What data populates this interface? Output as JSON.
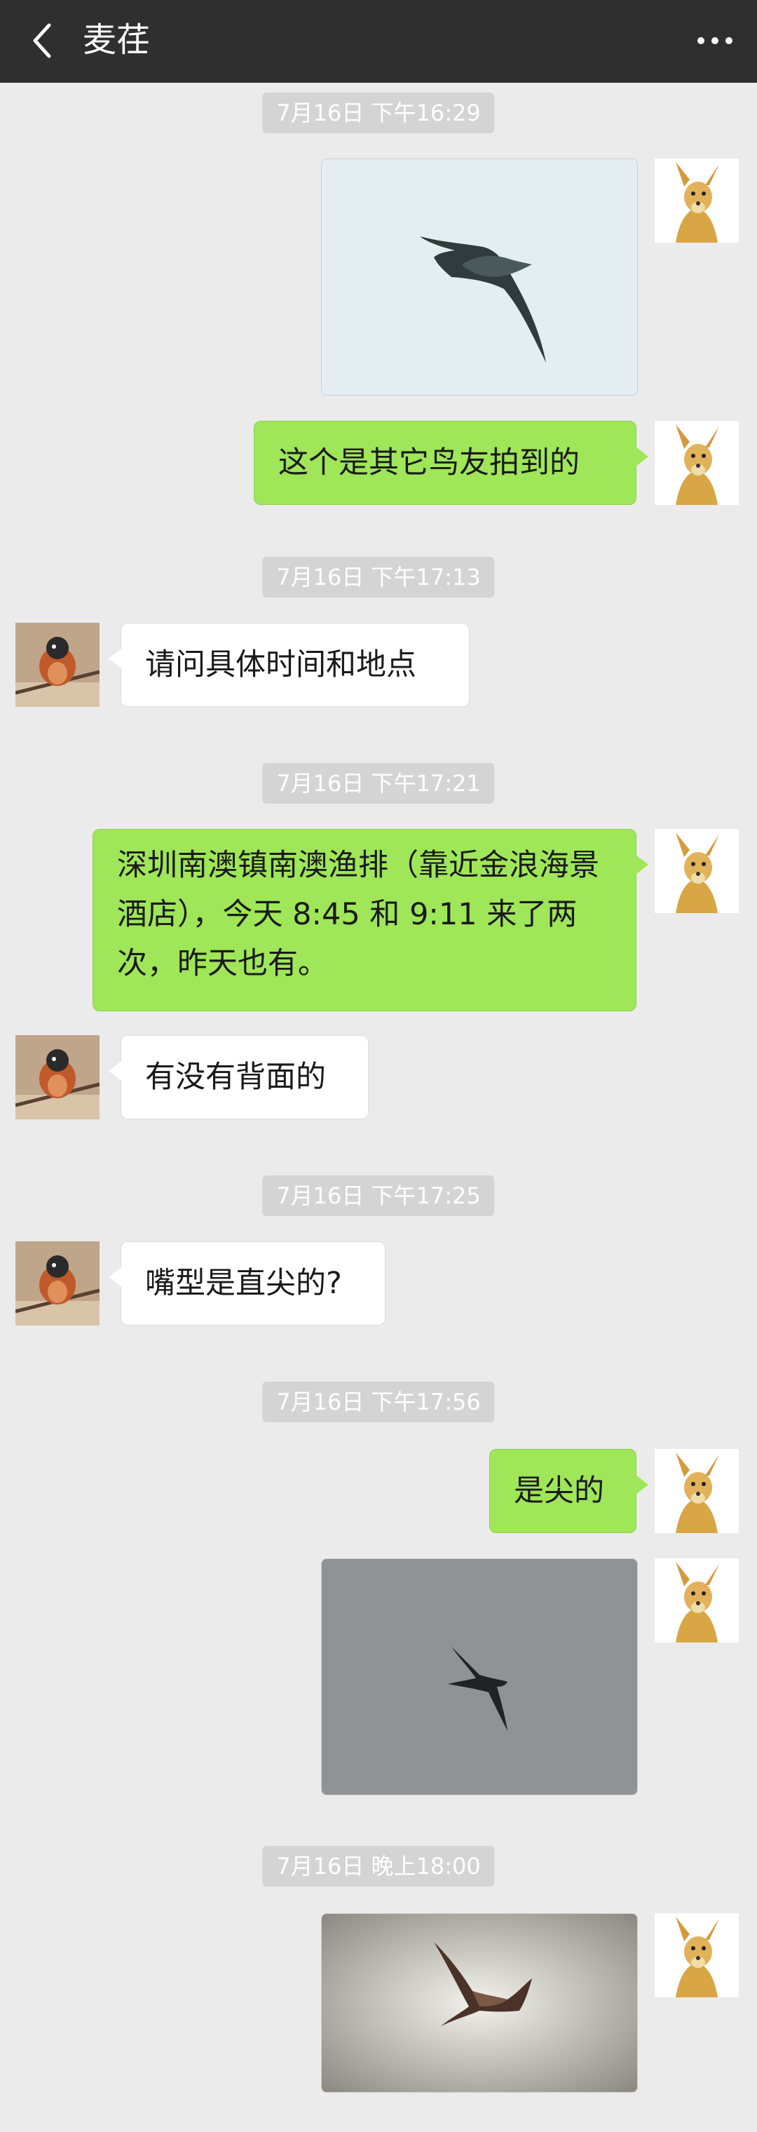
{
  "header": {
    "title": "麦荏",
    "back_icon": "chevron-left-icon",
    "more_icon": "more-horizontal-icon"
  },
  "timestamps": [
    "7月16日 下午16:29",
    "7月16日 下午17:13",
    "7月16日 下午17:21",
    "7月16日 下午17:25",
    "7月16日 下午17:56",
    "7月16日 晚上18:00"
  ],
  "messages": {
    "m1": "这个是其它鸟友拍到的",
    "m2": "请问具体时间和地点",
    "m3": "深圳南澳镇南澳渔排（靠近金浪海景酒店），今天 8:45 和 9:11 来了两次，昨天也有。",
    "m4": "有没有背面的",
    "m5": "嘴型是直尖的?",
    "m6": "是尖的"
  },
  "photos": [
    {
      "subject": "bird-in-flight",
      "background": "pale-blue-sky"
    },
    {
      "subject": "bird-in-flight",
      "background": "grey-sky"
    },
    {
      "subject": "bird-in-flight",
      "background": "hazy-sky"
    }
  ],
  "colors": {
    "header_bg": "#2f2f2f",
    "chat_bg": "#ebebeb",
    "my_bubble": "#9fe658",
    "their_bubble": "#ffffff",
    "timestamp_bg": "#d4d4d4"
  }
}
